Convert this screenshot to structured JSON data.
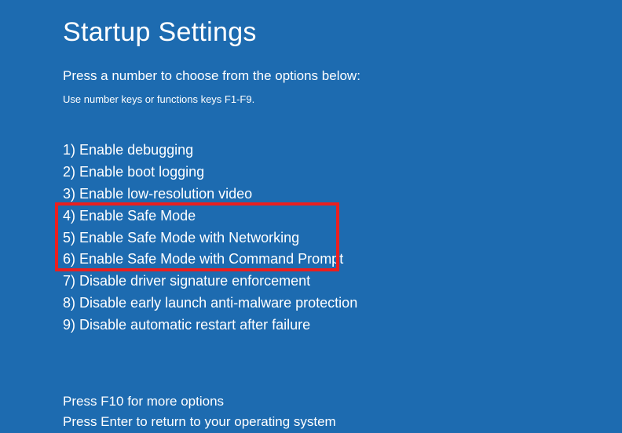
{
  "title": "Startup Settings",
  "subtitle": "Press a number to choose from the options below:",
  "hint": "Use number keys or functions keys F1-F9.",
  "options": [
    {
      "num": "1)",
      "label": "Enable debugging"
    },
    {
      "num": "2)",
      "label": "Enable boot logging"
    },
    {
      "num": "3)",
      "label": "Enable low-resolution video"
    },
    {
      "num": "4)",
      "label": "Enable Safe Mode"
    },
    {
      "num": "5)",
      "label": "Enable Safe Mode with Networking"
    },
    {
      "num": "6)",
      "label": "Enable Safe Mode with Command Prompt"
    },
    {
      "num": "7)",
      "label": "Disable driver signature enforcement"
    },
    {
      "num": "8)",
      "label": "Disable early launch anti-malware protection"
    },
    {
      "num": "9)",
      "label": "Disable automatic restart after failure"
    }
  ],
  "footer": {
    "more": "Press F10 for more options",
    "return": "Press Enter to return to your operating system"
  },
  "highlight_indices": [
    3,
    4,
    5
  ]
}
